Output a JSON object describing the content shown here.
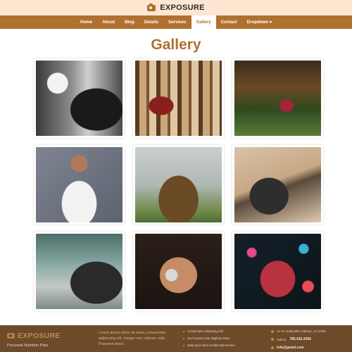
{
  "brand": {
    "name": "EXPOSURE",
    "icon": "camera-icon"
  },
  "nav": {
    "items": [
      {
        "label": "Home",
        "active": false
      },
      {
        "label": "About",
        "active": false
      },
      {
        "label": "Blog",
        "active": false
      },
      {
        "label": "Details",
        "active": false
      },
      {
        "label": "Services",
        "active": false
      },
      {
        "label": "Gallery",
        "active": true
      },
      {
        "label": "Contact",
        "active": false
      },
      {
        "label": "Dropdown ▾",
        "active": false
      }
    ]
  },
  "page": {
    "title": "Gallery"
  },
  "gallery": {
    "photos": [
      {
        "subject": "photographer-in-studio"
      },
      {
        "subject": "woman-with-camera-in-forest"
      },
      {
        "subject": "person-sitting-on-rock-in-woods"
      },
      {
        "subject": "man-holding-camera-white-shirt"
      },
      {
        "subject": "man-in-jacket-with-camera-field"
      },
      {
        "subject": "man-with-camera-on-tree-branch"
      },
      {
        "subject": "photographer-in-cap-street"
      },
      {
        "subject": "woman-with-camera-portrait"
      },
      {
        "subject": "man-with-camera-bokeh-lights"
      }
    ]
  },
  "footer": {
    "brand": "EXPOSURE",
    "tagline": "Personal Nutrition Plan",
    "lorem": "Lorem ipsum dolor sit amet, consectetur adipiscing elit. Integer nec odionec odio. Praesent libero.",
    "links": [
      "Consectetur Adipiscing Elit",
      "Sed Cursus Ante Dapibus Diam",
      "Nulla Quis Sem At Nibh Elementum"
    ],
    "contact": {
      "address": "12 Ad. Nulla Nibh Odionec, At 12345",
      "phone_prefix": "Call us:",
      "phone": "785.432.4356",
      "email": "info@gmail.com"
    }
  },
  "colors": {
    "accent": "#b0702e",
    "topbar": "#fde6d2",
    "footer": "#6c4a2a"
  }
}
